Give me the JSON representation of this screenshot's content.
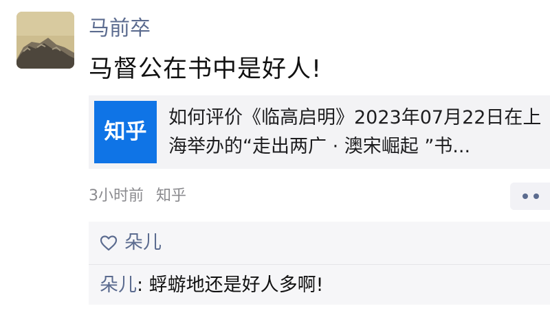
{
  "post": {
    "author": "马前卒",
    "content": "马督公在书中是好人!",
    "link": {
      "source_logo_text": "知乎",
      "title": "如何评价《临高启明》2023年07月22日在上海举办的“走出两广 · 澳宋崛起 ”书..."
    },
    "time": "3小时前",
    "source": "知乎",
    "more_icon": "more-dots-icon"
  },
  "interactions": {
    "heart_icon": "heart-icon",
    "likes": "朵儿",
    "comments": [
      {
        "user": "朵儿",
        "separator": ": ",
        "text": "蜉蝣地还是好人多啊!"
      }
    ]
  },
  "colors": {
    "name_blue": "#5b6b8f",
    "zhihu_blue": "#0f74e6",
    "card_bg": "#f3f3f5",
    "panel_bg": "#f6f6f8"
  }
}
